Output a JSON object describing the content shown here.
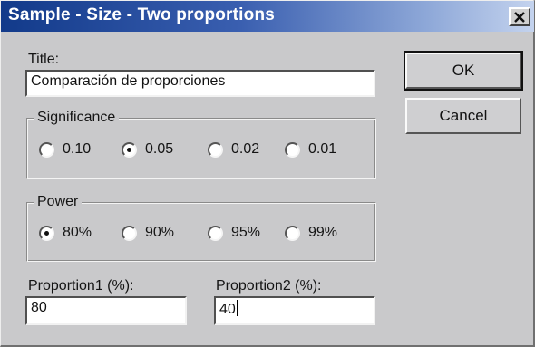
{
  "window": {
    "title": "Sample - Size - Two proportions"
  },
  "title_field": {
    "label": "Title:",
    "value": "Comparación de proporciones"
  },
  "significance": {
    "label": "Significance",
    "options": [
      "0.10",
      "0.05",
      "0.02",
      "0.01"
    ],
    "selected": "0.05"
  },
  "power": {
    "label": "Power",
    "options": [
      "80%",
      "90%",
      "95%",
      "99%"
    ],
    "selected": "80%"
  },
  "proportion1": {
    "label": "Proportion1 (%):",
    "value": "80"
  },
  "proportion2": {
    "label": "Proportion2 (%):",
    "value": "40"
  },
  "buttons": {
    "ok_label": "OK",
    "cancel_label": "Cancel"
  },
  "colors": {
    "titlebar_start": "#123a8a",
    "titlebar_end": "#c4d3ee",
    "dialog_bg": "#c9c9cb"
  }
}
